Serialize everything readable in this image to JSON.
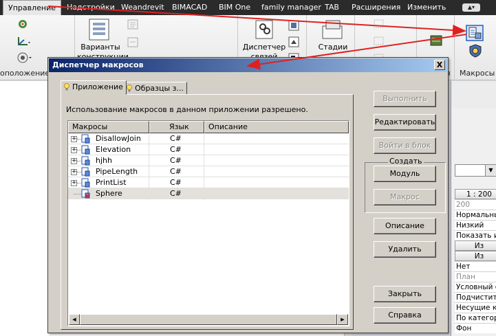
{
  "ribbon": {
    "tabs": [
      "Управление",
      "Надстройки",
      "Weandrevit",
      "BIMACAD",
      "BIM One",
      "family manager",
      "TAB",
      "Расширения",
      "Изменить"
    ],
    "active_tab": "Управление",
    "labels": {
      "variants": "Варианты",
      "variants2": "конструкции",
      "dispatcher": "Диспетчер",
      "dispatcher2": "связей",
      "stages": "Стадии"
    },
    "panels": {
      "left": "оположение проекта",
      "partial": "я",
      "macros": "Макросы"
    }
  },
  "dialog": {
    "title": "Диспетчер макросов",
    "close_label": "X",
    "tabs": [
      "Приложение",
      "Образцы з..."
    ],
    "info": "Использование макросов в данном приложении разрешено.",
    "columns": [
      "Макросы",
      "Язык",
      "Описание"
    ],
    "rows": [
      {
        "name": "DisallowJoin",
        "lang": "C#",
        "desc": "",
        "icon": "module-icon"
      },
      {
        "name": "Elevation",
        "lang": "C#",
        "desc": "",
        "icon": "module-icon"
      },
      {
        "name": "hjhh",
        "lang": "C#",
        "desc": "",
        "icon": "module-icon"
      },
      {
        "name": "PipeLength",
        "lang": "C#",
        "desc": "",
        "icon": "module-icon"
      },
      {
        "name": "PrintList",
        "lang": "C#",
        "desc": "",
        "icon": "module-icon"
      },
      {
        "name": "Sphere",
        "lang": "C#",
        "desc": "",
        "icon": "module-error-icon"
      }
    ],
    "buttons": {
      "run": "Выполнить",
      "edit": "Редактировать",
      "step_into": "Войти в блок",
      "create_group": "Создать",
      "module": "Модуль",
      "macro": "Макрос",
      "description": "Описание",
      "delete": "Удалить",
      "close": "Закрыть",
      "help": "Справка"
    }
  },
  "properties": {
    "scale": "1 : 200",
    "rows": [
      "200",
      "Нормальный",
      "Низкий",
      "Показать и",
      "Из",
      "Из",
      "Нет",
      "План",
      "Условный с",
      "Подчистить",
      "Несущие ко",
      "По категори",
      "Фон"
    ]
  },
  "colors": {
    "title_start": "#0a246a",
    "title_end": "#a6caf0",
    "annotation_arrow": "#e02020"
  }
}
